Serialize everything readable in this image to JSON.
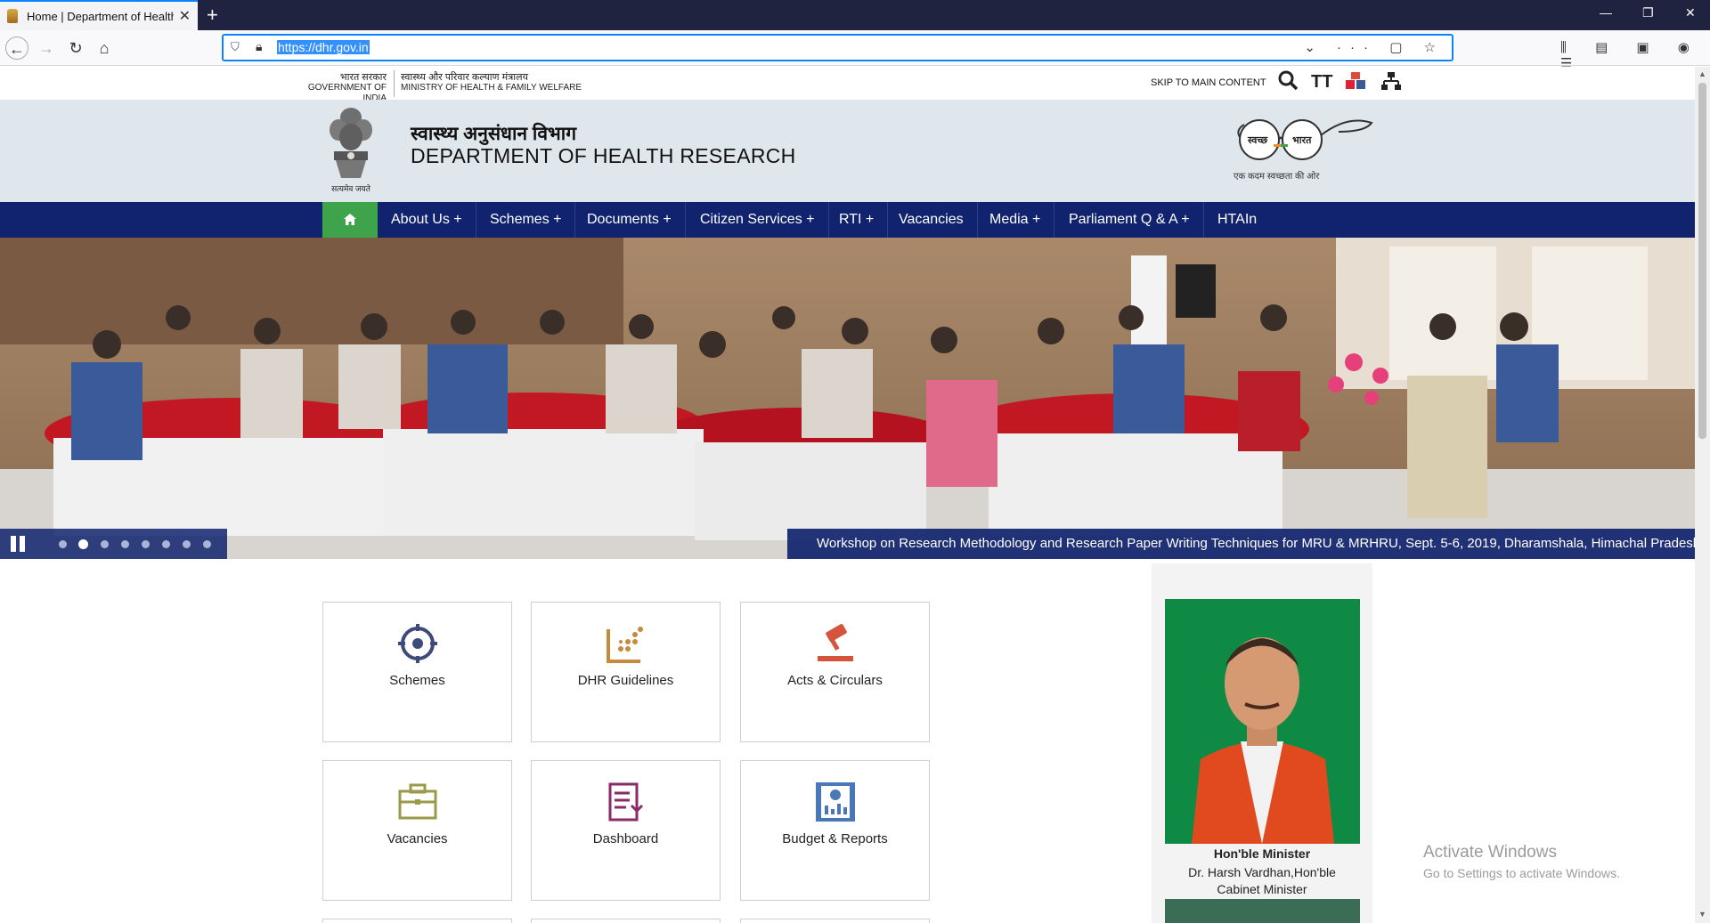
{
  "browser": {
    "tab_title": "Home | Department of Health Research",
    "url": "https://dhr.gov.in",
    "new_tab": "+",
    "close_tab": "✕",
    "window_minimize": "—",
    "window_restore": "❐",
    "window_close": "✕"
  },
  "topstrip": {
    "gov_hi": "भारत सरकार",
    "gov_en": "GOVERNMENT OF INDIA",
    "ministry_hi": "स्वास्थ्य और परिवार कल्याण मंत्रालय",
    "ministry_en": "MINISTRY OF HEALTH & FAMILY WELFARE",
    "skip_link": "SKIP TO MAIN CONTENT",
    "text_size_icon": "TT"
  },
  "header": {
    "emblem_caption": "सत्यमेव जयते",
    "dept_hi": "स्वास्थ्य अनुसंधान विभाग",
    "dept_en": "DEPARTMENT OF HEALTH RESEARCH",
    "swachh_left": "स्वच्छ",
    "swachh_right": "भारत",
    "swachh_caption": "एक कदम स्वच्छता की ओर"
  },
  "menu": {
    "home_icon": "home-icon",
    "items": [
      {
        "label": "About Us +"
      },
      {
        "label": "Schemes +"
      },
      {
        "label": "Documents +"
      },
      {
        "label": "Citizen Services +"
      },
      {
        "label": "RTI +"
      },
      {
        "label": "Vacancies"
      },
      {
        "label": "Media +"
      },
      {
        "label": "Parliament Q & A +"
      },
      {
        "label": "HTAIn"
      }
    ]
  },
  "banner": {
    "caption": "Workshop on Research Methodology and Research Paper Writing Techniques for MRU & MRHRU, Sept. 5-6, 2019, Dharamshala, Himachal Pradesh",
    "slide_count": 8,
    "active_slide": 2
  },
  "tiles": [
    {
      "label": "Schemes",
      "icon": "schemes-icon",
      "color": "#3d4b7a"
    },
    {
      "label": "DHR Guidelines",
      "icon": "guidelines-icon",
      "color": "#c68a3a"
    },
    {
      "label": "Acts & Circulars",
      "icon": "gavel-icon",
      "color": "#d4553b"
    },
    {
      "label": "Vacancies",
      "icon": "briefcase-icon",
      "color": "#9a9a4a"
    },
    {
      "label": "Dashboard",
      "icon": "dashboard-icon",
      "color": "#8a2a6a"
    },
    {
      "label": "Budget & Reports",
      "icon": "report-icon",
      "color": "#4a77b5"
    }
  ],
  "minister": {
    "title": "Hon'ble Minister",
    "name_line": "Dr. Harsh Vardhan,Hon'ble",
    "role_line": "Cabinet Minister"
  },
  "os_overlay": {
    "line1": "Activate Windows",
    "line2": "Go to Settings to activate Windows."
  },
  "colors": {
    "menu_bg": "#11236e",
    "home_bg": "#3ea34b",
    "header_bg": "#dfe6ec"
  }
}
